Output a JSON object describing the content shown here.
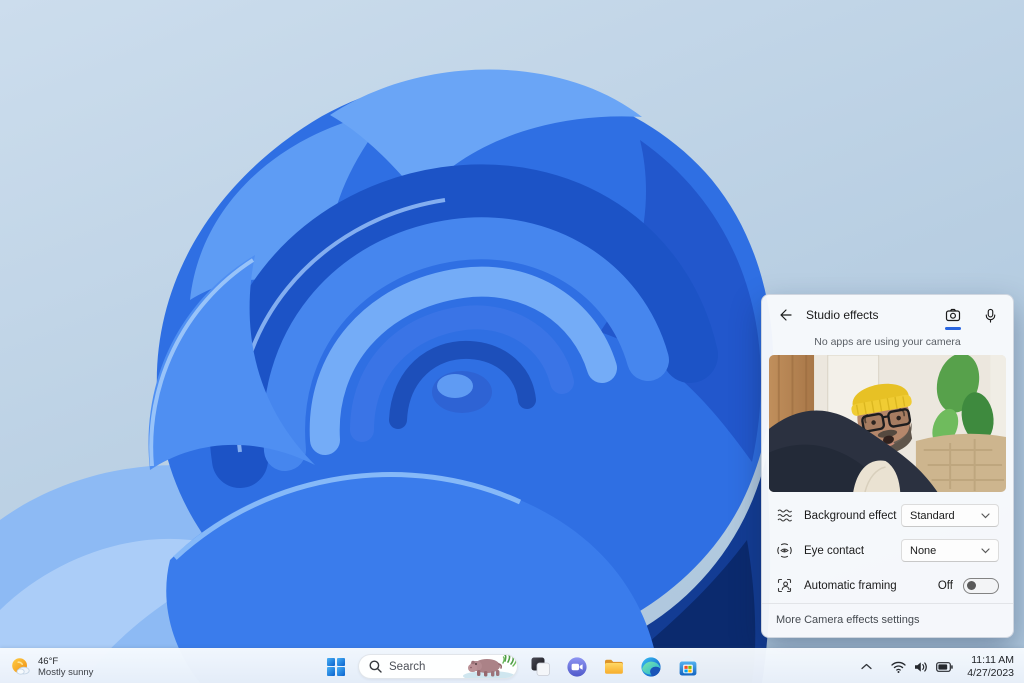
{
  "colors": {
    "accent": "#2a66e0",
    "wallpaper_background": "#c3d6e6",
    "wallpaper_blue_main": "#2f6fe3",
    "wallpaper_blue_navy": "#133c94",
    "panel_background": "#f7f9fc",
    "taskbar_background": "#eef4fb"
  },
  "panel": {
    "title": "Studio effects",
    "status": "No apps are using your camera",
    "header_icons": [
      "back-arrow-icon",
      "camera-icon (selected, blue underline)",
      "microphone-icon"
    ],
    "rows": [
      {
        "icon": "background-blur-icon",
        "label": "Background effect",
        "control": "dropdown",
        "value": "Standard"
      },
      {
        "icon": "eye-contact-icon",
        "label": "Eye contact",
        "control": "dropdown",
        "value": "None"
      },
      {
        "icon": "automatic-framing-icon",
        "label": "Automatic framing",
        "control": "toggle",
        "value": "Off"
      }
    ],
    "footer": "More Camera effects settings",
    "preview_description": "Webcam preview: man with yellow beanie, black glasses, gray beard, dark jacket leaning into frame; wood wall left, green plant and tan couch right"
  },
  "taskbar": {
    "weather": {
      "temperature": "46°F",
      "condition": "Mostly sunny",
      "icon": "mostly-sunny-icon"
    },
    "search_placeholder": "Search",
    "search_icons": [
      "magnifier-icon",
      "bing-daily-hippo-art"
    ],
    "apps": [
      {
        "name": "start"
      },
      {
        "name": "search"
      },
      {
        "name": "task-view"
      },
      {
        "name": "chat"
      },
      {
        "name": "file-explorer"
      },
      {
        "name": "edge"
      },
      {
        "name": "microsoft-store"
      }
    ],
    "tray": {
      "icons": [
        "chevron-up-icon",
        "wifi-icon",
        "volume-icon",
        "battery-icon"
      ],
      "time": "11:11 AM",
      "date": "4/27/2023"
    }
  }
}
